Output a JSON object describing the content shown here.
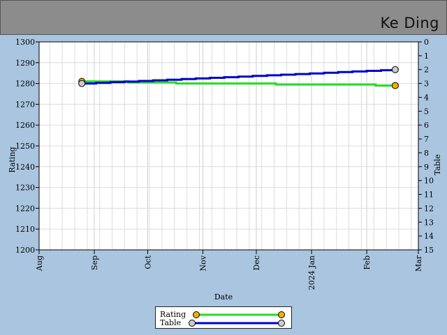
{
  "header": {
    "player_name": "Ke Ding"
  },
  "colors": {
    "rating": "#22dd22",
    "table": "#0000cc",
    "rating_marker": "#f0b000",
    "table_marker": "#cccccc",
    "background": "#a9c5df",
    "header": "#8c8c8c"
  },
  "chart_data": {
    "type": "line",
    "xlabel": "Date",
    "ylabel": "Rating",
    "y2label": "Table",
    "ylim": [
      1200,
      1300
    ],
    "y2lim": [
      0,
      15
    ],
    "y2_inverted": true,
    "xlim": [
      "2023-08-01",
      "2024-03-01"
    ],
    "x_ticks": [
      "Aug",
      "Sep",
      "Oct",
      "Nov",
      "Dec",
      "2024 Jan",
      "Feb",
      "Mar"
    ],
    "y_ticks": [
      1200,
      1210,
      1220,
      1230,
      1240,
      1250,
      1260,
      1270,
      1280,
      1290,
      1300
    ],
    "y2_ticks": [
      0,
      1,
      2,
      3,
      4,
      5,
      6,
      7,
      8,
      9,
      10,
      11,
      12,
      13,
      14,
      15
    ],
    "grid": true,
    "legend_position": "bottom",
    "series": [
      {
        "name": "Rating",
        "axis": "left",
        "x": [
          "2023-08-25",
          "2023-09-20",
          "2023-10-17",
          "2023-11-14",
          "2023-12-12",
          "2024-01-09",
          "2024-02-06",
          "2024-02-17"
        ],
        "values": [
          1281,
          1280.5,
          1280,
          1280,
          1279.5,
          1279.5,
          1279,
          1279
        ]
      },
      {
        "name": "Table",
        "axis": "right",
        "x": [
          "2023-08-25",
          "2024-02-17"
        ],
        "values": [
          3,
          2
        ]
      }
    ]
  }
}
